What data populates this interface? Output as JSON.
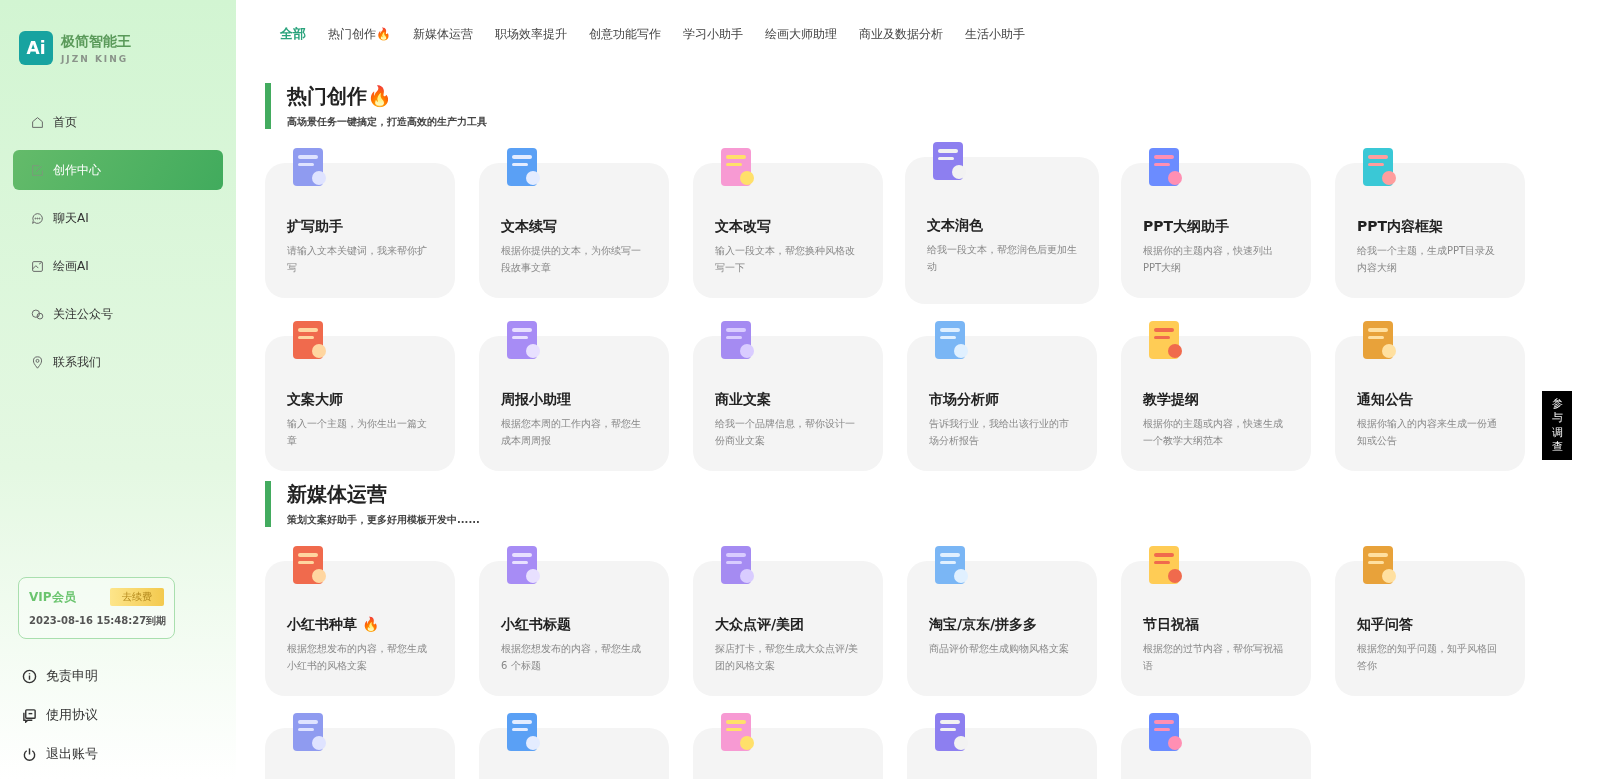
{
  "brand": {
    "logo_mark": "Ai",
    "name": "极简智能王",
    "subtitle": "JJZN KING"
  },
  "sidebar": {
    "items": [
      {
        "label": "首页",
        "kind": "home",
        "selected": false
      },
      {
        "label": "创作中心",
        "kind": "edit",
        "selected": true
      },
      {
        "label": "聊天AI",
        "kind": "chat",
        "selected": false
      },
      {
        "label": "绘画AI",
        "kind": "image",
        "selected": false
      },
      {
        "label": "关注公众号",
        "kind": "follow",
        "selected": false
      },
      {
        "label": "联系我们",
        "kind": "location",
        "selected": false
      }
    ],
    "vip": {
      "title": "VIP会员",
      "button": "去续费",
      "expiry": "2023-08-16 15:48:27到期"
    },
    "footer_items": [
      {
        "label": "免责申明",
        "kind": "info"
      },
      {
        "label": "使用协议",
        "kind": "agreement"
      },
      {
        "label": "退出账号",
        "kind": "power"
      }
    ]
  },
  "tabs": [
    {
      "label": "全部",
      "selected": true
    },
    {
      "label": "热门创作🔥",
      "selected": false
    },
    {
      "label": "新媒体运营",
      "selected": false
    },
    {
      "label": "职场效率提升",
      "selected": false
    },
    {
      "label": "创意功能写作",
      "selected": false
    },
    {
      "label": "学习小助手",
      "selected": false
    },
    {
      "label": "绘画大师助理",
      "selected": false
    },
    {
      "label": "商业及数据分析",
      "selected": false
    },
    {
      "label": "生活小助手",
      "selected": false
    }
  ],
  "sections": [
    {
      "title": "热门创作🔥",
      "subtitle": "高场景任务一键搞定，打造高效的生产力工具",
      "cards": [
        {
          "kind": "full",
          "title": "扩写助手",
          "description": "请输入文本关键词，我来帮你扩写",
          "highlighted": false
        },
        {
          "kind": "full",
          "title": "文本续写",
          "description": "根据你提供的文本，为你续写一段故事文章",
          "highlighted": false
        },
        {
          "kind": "full",
          "title": "文本改写",
          "description": "输入一段文本，帮您换种风格改写一下",
          "highlighted": false
        },
        {
          "kind": "full",
          "title": "文本润色",
          "description": "给我一段文本，帮您润色后更加生动",
          "highlighted": true
        },
        {
          "kind": "full",
          "title": "PPT大纲助手",
          "description": "根据你的主题内容，快速列出PPT大纲",
          "highlighted": false
        },
        {
          "kind": "full",
          "title": "PPT内容框架",
          "description": "给我一个主题，生成PPT目录及内容大纲",
          "highlighted": false
        },
        {
          "kind": "full",
          "title": "文案大师",
          "description": "输入一个主题，为你生出一篇文章",
          "highlighted": false
        },
        {
          "kind": "full",
          "title": "周报小助理",
          "description": "根据您本周的工作内容，帮您生成本周周报",
          "highlighted": false
        },
        {
          "kind": "full",
          "title": "商业文案",
          "description": "给我一个品牌信息，帮你设计一份商业文案",
          "highlighted": false
        },
        {
          "kind": "full",
          "title": "市场分析师",
          "description": "告诉我行业，我给出该行业的市场分析报告",
          "highlighted": false
        },
        {
          "kind": "full",
          "title": "教学提纲",
          "description": "根据你的主题或内容，快速生成一个教学大纲范本",
          "highlighted": false
        },
        {
          "kind": "full",
          "title": "通知公告",
          "description": "根据你输入的内容来生成一份通知或公告",
          "highlighted": false
        }
      ]
    },
    {
      "title": "新媒体运营",
      "subtitle": "策划文案好助手，更多好用模板开发中......",
      "cards": [
        {
          "kind": "full",
          "title": "小红书种草 🔥",
          "description": "根据您想发布的内容，帮您生成小红书的风格文案",
          "highlighted": false
        },
        {
          "kind": "full",
          "title": "小红书标题",
          "description": "根据您想发布的内容，帮您生成 6 个标题",
          "highlighted": false
        },
        {
          "kind": "full",
          "title": "大众点评/美团",
          "description": "探店打卡，帮您生成大众点评/美团的风格文案",
          "highlighted": false
        },
        {
          "kind": "full",
          "title": "淘宝/京东/拼多多",
          "description": "商品评价帮您生成购物风格文案",
          "highlighted": false
        },
        {
          "kind": "full",
          "title": "节日祝福",
          "description": "根据您的过节内容，帮你写祝福语",
          "highlighted": false
        },
        {
          "kind": "full",
          "title": "知乎问答",
          "description": "根据您的知乎问题，知乎风格回答你",
          "highlighted": false
        },
        {
          "kind": "partial",
          "highlighted": false
        },
        {
          "kind": "partial",
          "highlighted": false
        },
        {
          "kind": "partial",
          "highlighted": false
        },
        {
          "kind": "partial",
          "highlighted": false
        },
        {
          "kind": "partial",
          "highlighted": false
        }
      ]
    }
  ],
  "survey_tab": "参与调查"
}
